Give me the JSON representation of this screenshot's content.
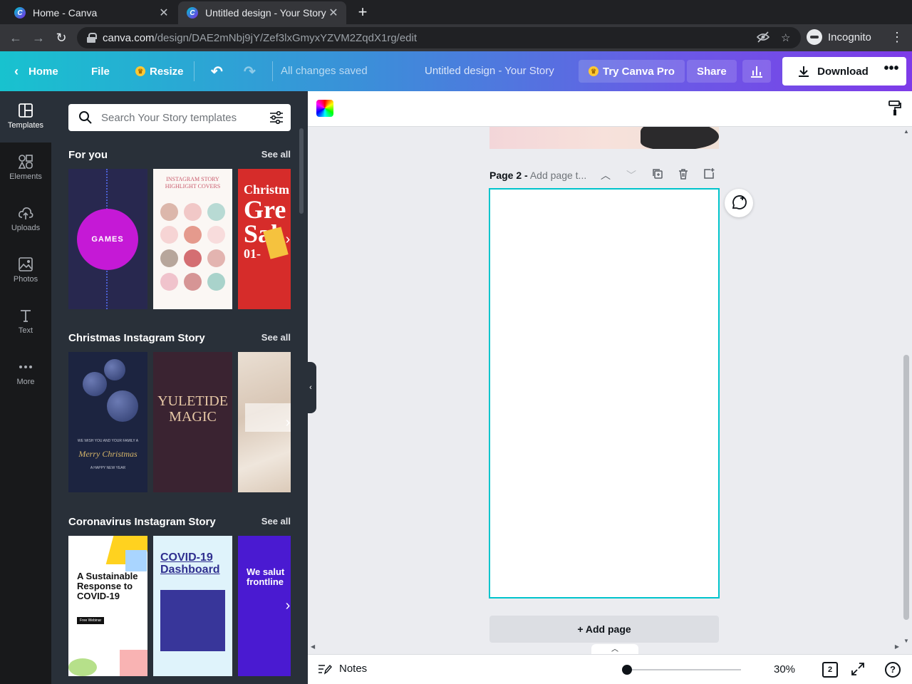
{
  "browser": {
    "tabs": [
      {
        "title": "Home - Canva"
      },
      {
        "title": "Untitled design - Your Story"
      }
    ],
    "url_host": "canva.com",
    "url_path": "/design/DAE2mNbj9jY/Zef3lxGmyxYZVM2ZqdX1rg/edit",
    "incognito_label": "Incognito"
  },
  "header": {
    "home": "Home",
    "file": "File",
    "resize": "Resize",
    "status": "All changes saved",
    "doc_title": "Untitled design - Your Story",
    "try_pro": "Try Canva Pro",
    "share": "Share",
    "download": "Download",
    "more": "•••"
  },
  "rail": {
    "items": [
      {
        "label": "Templates",
        "icon": "templates-icon"
      },
      {
        "label": "Elements",
        "icon": "elements-icon"
      },
      {
        "label": "Uploads",
        "icon": "uploads-icon"
      },
      {
        "label": "Photos",
        "icon": "photos-icon"
      },
      {
        "label": "Text",
        "icon": "text-icon"
      },
      {
        "label": "More",
        "icon": "more-icon"
      }
    ]
  },
  "panel": {
    "search_placeholder": "Search Your Story templates",
    "sections": [
      {
        "title": "For you",
        "see_all": "See all"
      },
      {
        "title": "Christmas Instagram Story",
        "see_all": "See all"
      },
      {
        "title": "Coronavirus Instagram Story",
        "see_all": "See all"
      }
    ],
    "thumbs": {
      "games": "GAMES",
      "highlight_title": "INSTAGRAM STORY HIGHLIGHT COVERS",
      "xmas_line1": "Christm",
      "xmas_line2": "Gre",
      "xmas_line3": "Sal",
      "xmas_line4": "01-",
      "navy_msg": "WE WISH YOU AND YOUR FAMILY A",
      "navy_merry": "Merry Christmas",
      "navy_new_year": "A HAPPY NEW YEAR",
      "yuletide": "YULETIDE MAGIC",
      "covid1_heading": "A Sustainable Response to COVID-19",
      "covid1_pill": "Free Webinar",
      "covid2_title": "COVID-19 Dashboard",
      "covid3_title": "We salut frontline"
    }
  },
  "canvas": {
    "page_label_bold": "Page 2 -",
    "page_label_placeholder": "Add page t...",
    "add_page": "+ Add page"
  },
  "bottom": {
    "notes": "Notes",
    "zoom": "30%",
    "zoom_fraction": 0.3,
    "page_count": "2",
    "help": "?"
  }
}
